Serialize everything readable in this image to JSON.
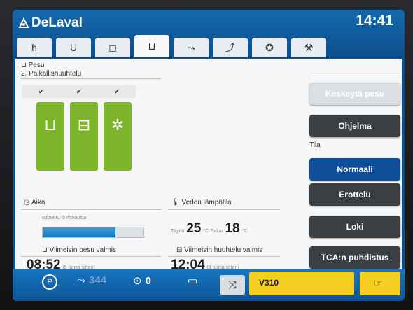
{
  "brand": {
    "name": "DeLaval"
  },
  "clock": "14:41",
  "tabs": [
    {
      "icon": "milking-icon",
      "glyph": "h"
    },
    {
      "icon": "udder-icon",
      "glyph": "U"
    },
    {
      "icon": "tank-icon",
      "glyph": "◻"
    },
    {
      "icon": "wash-icon",
      "glyph": "⊔"
    },
    {
      "icon": "cow-icon",
      "glyph": "⤳"
    },
    {
      "icon": "run-icon",
      "glyph": "⤴"
    },
    {
      "icon": "gear-icon",
      "glyph": "✪"
    },
    {
      "icon": "tools-icon",
      "glyph": "⚒"
    }
  ],
  "section": {
    "title": "Pesu",
    "subtitle": "2. Paikallishuuhtelu"
  },
  "checks": [
    "✔",
    "✔",
    "✔"
  ],
  "time": {
    "label": "Aika",
    "expected": "odotettu: 5 minuuttia",
    "progress": 0.72
  },
  "temperature": {
    "label": "Veden lämpötila",
    "fill_label": "Täyttö",
    "fill_value": "25",
    "unit1": "°C",
    "return_label": "Paluu",
    "return_value": "18",
    "unit2": "°C"
  },
  "last_wash": {
    "label": "Viimeisin pesu valmis",
    "time": "08:52",
    "ago": "(5 tuntia sitten)"
  },
  "last_rinse": {
    "label": "Viimeisin huuhtelu valmis",
    "time": "12:04",
    "ago": "(3 tuntia sitten)"
  },
  "buttons": {
    "stop": "Keskeytä pesu",
    "program": "Ohjelma",
    "mode_label": "Tila",
    "normal": "Normaali",
    "separation": "Erottelu",
    "log": "Loki",
    "tca": "TCA:n puhdistus"
  },
  "bottom": {
    "count": "344",
    "zero": "0",
    "unit": "V310"
  },
  "colors": {
    "accent_blue": "#0c4f8a",
    "green": "#7fb52c",
    "yellow": "#f5cf22",
    "dark_button": "#3c3f42",
    "selected": "#0f4f9a"
  }
}
